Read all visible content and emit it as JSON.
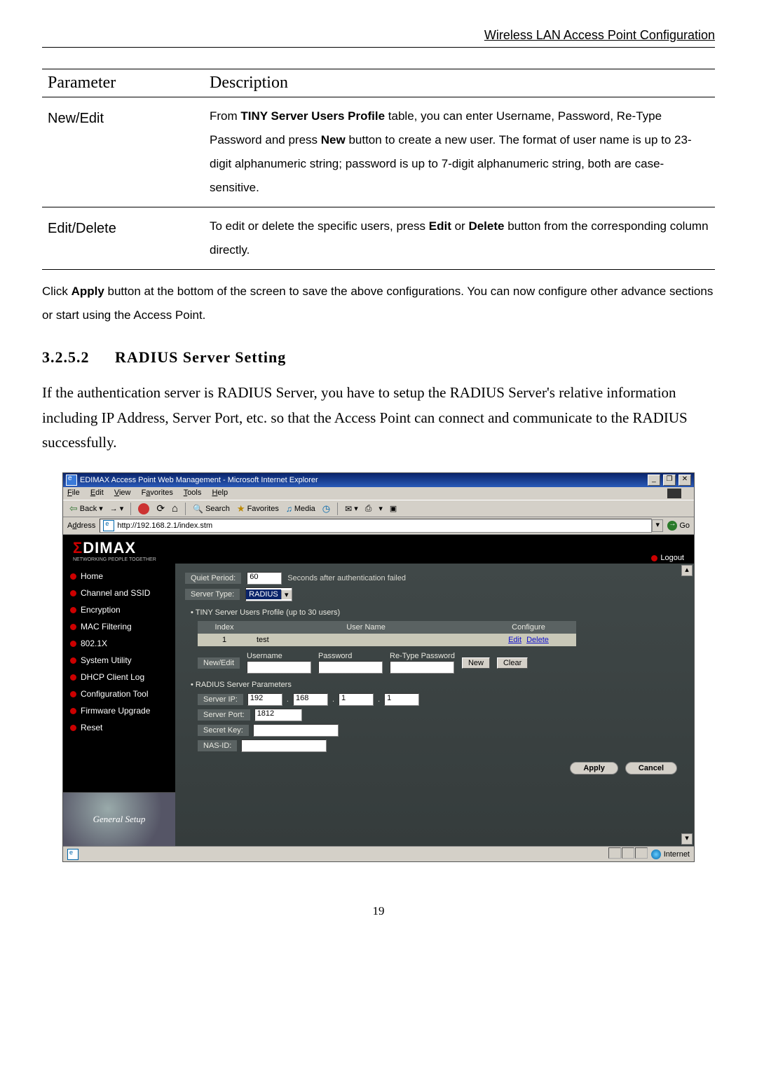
{
  "header": "Wireless LAN Access Point Configuration",
  "table": {
    "cols": [
      "Parameter",
      "Description"
    ],
    "rows": [
      {
        "param": "New/Edit",
        "desc": "From <b>TINY Server Users Profile</b> table, you can enter Username, Password, Re-Type Password and press <b>New</b> button to create a new user. The format of user name is up to 23-digit alphanumeric string; password is up to 7-digit alphanumeric string, both are case-sensitive."
      },
      {
        "param": "Edit/Delete",
        "desc": "To edit or delete the specific users, press <b>Edit</b> or <b>Delete</b> button from the corresponding column directly."
      }
    ]
  },
  "under_table": "Click <b>Apply</b> button at the bottom of the screen to save the above configurations. You can now configure other advance sections or start using the Access Point.",
  "section": {
    "num": "3.2.5.2",
    "title": "RADIUS Server Setting"
  },
  "intro": "If the authentication server is RADIUS Server, you have to setup the RADIUS Server's relative information including IP Address, Server Port, etc. so that the Access Point can connect and communicate to the RADIUS successfully.",
  "ie": {
    "title": "EDIMAX Access Point Web Management - Microsoft Internet Explorer",
    "menus": [
      "File",
      "Edit",
      "View",
      "Favorites",
      "Tools",
      "Help"
    ],
    "toolbar": {
      "back": "Back",
      "search": "Search",
      "favorites": "Favorites",
      "media": "Media"
    },
    "address_label": "Address",
    "address": "http://192.168.2.1/index.stm",
    "go": "Go",
    "status_zone": "Internet"
  },
  "brand": {
    "name": "EDIMAX",
    "sub": "NETWORKING PEOPLE TOGETHER"
  },
  "logout": "Logout",
  "sidebar": [
    "Home",
    "Channel and SSID",
    "Encryption",
    "MAC Filtering",
    "802.1X",
    "System Utility",
    "DHCP Client Log",
    "Configuration Tool",
    "Firmware Upgrade",
    "Reset"
  ],
  "side_footer": "General Setup",
  "content": {
    "quiet_label": "Quiet Period:",
    "quiet_value": "60",
    "quiet_hint": "Seconds after authentication failed",
    "server_type_label": "Server Type:",
    "server_type_value": "RADIUS",
    "section_users": "TINY Server Users Profile (up to 30 users)",
    "user_cols": [
      "Index",
      "User Name",
      "Configure"
    ],
    "user_row": {
      "index": "1",
      "name": "test",
      "edit": "Edit",
      "delete": "Delete"
    },
    "newedit": {
      "tag": "New/Edit",
      "username": "Username",
      "password": "Password",
      "retype": "Re-Type Password",
      "btn_new": "New",
      "btn_clear": "Clear"
    },
    "section_radius": "RADIUS Server Parameters",
    "params": {
      "server_ip": "Server IP:",
      "ip": [
        "192",
        "168",
        "1",
        "1"
      ],
      "server_port": "Server Port:",
      "port": "1812",
      "secret": "Secret Key:",
      "nas": "NAS-ID:"
    },
    "apply": "Apply",
    "cancel": "Cancel"
  },
  "page_number": "19"
}
